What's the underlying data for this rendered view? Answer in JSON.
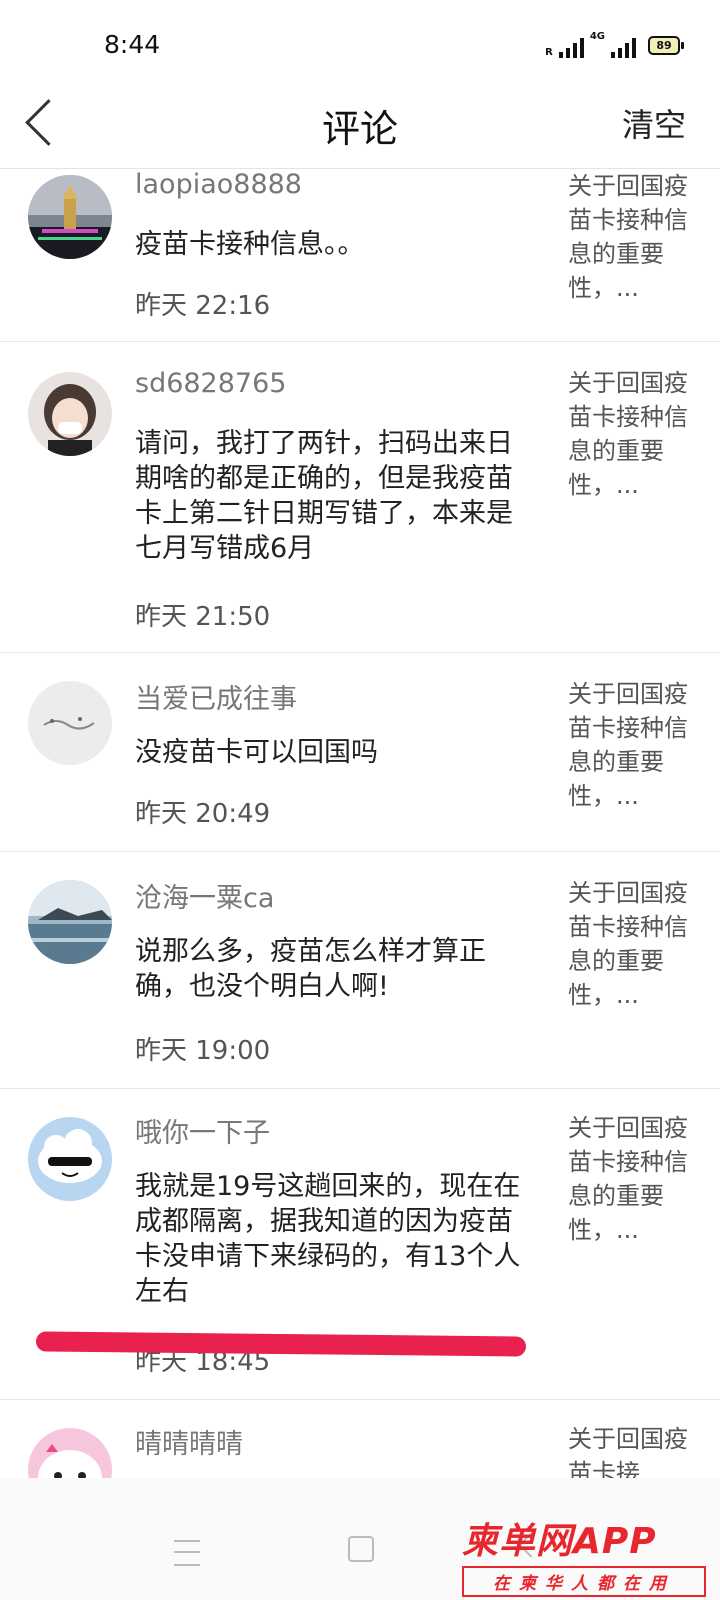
{
  "status_bar": {
    "time": "8:44",
    "roaming": "R",
    "network": "4G",
    "battery": "89"
  },
  "header": {
    "back_icon": "chevron-left-icon",
    "title": "评论",
    "clear_label": "清空"
  },
  "comments": [
    {
      "username": "laopiao8888",
      "text": "疫苗卡接种信息。。",
      "time": "昨天 22:16",
      "article_ref": "关于回国疫苗卡接种信息的重要性，..."
    },
    {
      "username": "sd6828765",
      "text": "请问，我打了两针，扫码出来日期啥的都是正确的，但是我疫苗卡上第二针日期写错了，本来是七月写错成6月",
      "time": "昨天 21:50",
      "article_ref": "关于回国疫苗卡接种信息的重要性，..."
    },
    {
      "username": "当爱已成往事",
      "text": "没疫苗卡可以回国吗",
      "time": "昨天 20:49",
      "article_ref": "关于回国疫苗卡接种信息的重要性，..."
    },
    {
      "username": "沧海一粟ca",
      "text": "说那么多，疫苗怎么样才算正确，也没个明白人啊!",
      "time": "昨天 19:00",
      "article_ref": "关于回国疫苗卡接种信息的重要性，..."
    },
    {
      "username": "哦你一下子",
      "text": "我就是19号这趟回来的，现在在成都隔离，据我知道的因为疫苗卡没申请下来绿码的，有13个人左右",
      "time": "昨天 18:45",
      "article_ref": "关于回国疫苗卡接种信息的重要性，..."
    },
    {
      "username": "晴晴晴晴",
      "text": "",
      "time": "",
      "article_ref": "关于回国疫苗卡接"
    }
  ],
  "annotation_color": "#e8214e",
  "watermark": {
    "main": "柬单网APP",
    "sub": "在柬华人都在用",
    "color": "#e8262d"
  }
}
